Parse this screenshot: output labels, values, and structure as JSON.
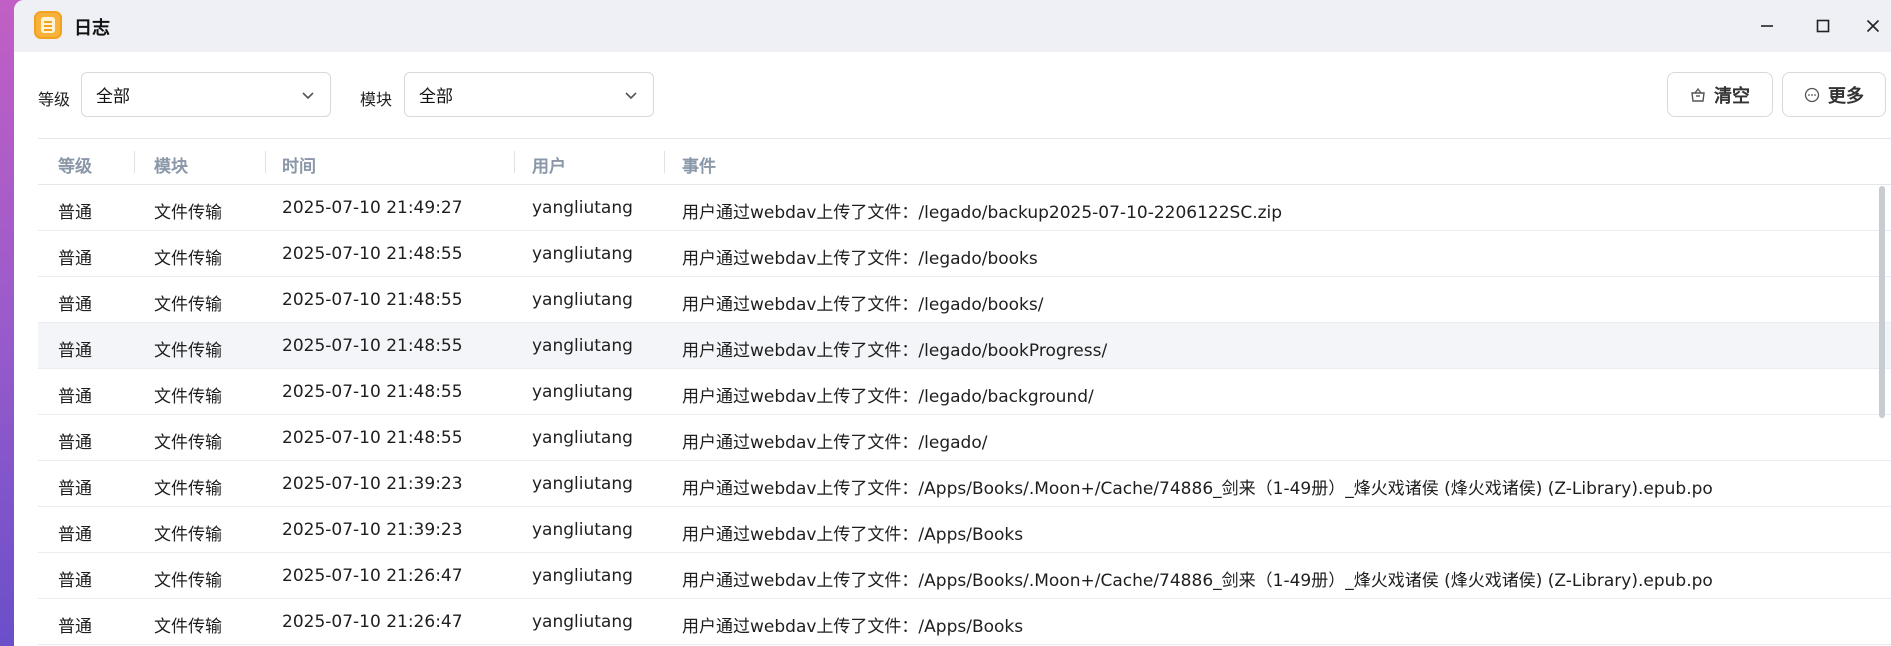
{
  "window": {
    "title": "日志"
  },
  "filters": {
    "level_label": "等级",
    "level_value": "全部",
    "module_label": "模块",
    "module_value": "全部"
  },
  "actions": {
    "clear_label": "清空",
    "more_label": "更多"
  },
  "table": {
    "columns": [
      "等级",
      "模块",
      "时间",
      "用户",
      "事件"
    ],
    "rows": [
      [
        "普通",
        "文件传输",
        "2025-07-10 21:49:27",
        "yangliutang",
        "用户通过webdav上传了文件：/legado/backup2025-07-10-2206122SC.zip"
      ],
      [
        "普通",
        "文件传输",
        "2025-07-10 21:48:55",
        "yangliutang",
        "用户通过webdav上传了文件：/legado/books"
      ],
      [
        "普通",
        "文件传输",
        "2025-07-10 21:48:55",
        "yangliutang",
        "用户通过webdav上传了文件：/legado/books/"
      ],
      [
        "普通",
        "文件传输",
        "2025-07-10 21:48:55",
        "yangliutang",
        "用户通过webdav上传了文件：/legado/bookProgress/"
      ],
      [
        "普通",
        "文件传输",
        "2025-07-10 21:48:55",
        "yangliutang",
        "用户通过webdav上传了文件：/legado/background/"
      ],
      [
        "普通",
        "文件传输",
        "2025-07-10 21:48:55",
        "yangliutang",
        "用户通过webdav上传了文件：/legado/"
      ],
      [
        "普通",
        "文件传输",
        "2025-07-10 21:39:23",
        "yangliutang",
        "用户通过webdav上传了文件：/Apps/Books/.Moon+/Cache/74886_剑来（1-49册）_烽火戏诸侯 (烽火戏诸侯) (Z-Library).epub.po"
      ],
      [
        "普通",
        "文件传输",
        "2025-07-10 21:39:23",
        "yangliutang",
        "用户通过webdav上传了文件：/Apps/Books"
      ],
      [
        "普通",
        "文件传输",
        "2025-07-10 21:26:47",
        "yangliutang",
        "用户通过webdav上传了文件：/Apps/Books/.Moon+/Cache/74886_剑来（1-49册）_烽火戏诸侯 (烽火戏诸侯) (Z-Library).epub.po"
      ],
      [
        "普通",
        "文件传输",
        "2025-07-10 21:26:47",
        "yangliutang",
        "用户通过webdav上传了文件：/Apps/Books"
      ]
    ],
    "highlighted_row": 3
  },
  "icons": {
    "app": "log-app-icon",
    "minimize": "minimize-icon",
    "maximize": "maximize-icon",
    "close": "close-icon",
    "chevron": "chevron-down-icon",
    "clear": "basket-icon",
    "more": "more-dots-icon"
  },
  "colors": {
    "app_icon": "#f7b23b",
    "header_text": "#8a97a8",
    "highlight_row": "#f3f5f8"
  }
}
